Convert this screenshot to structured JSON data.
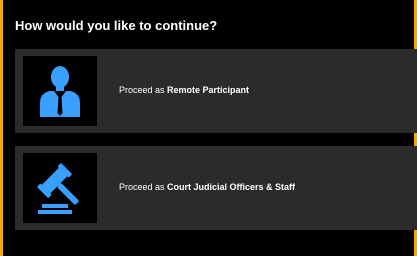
{
  "dialog": {
    "title": "How would you like to continue?"
  },
  "options": [
    {
      "prefix": "Proceed as ",
      "role": "Remote Participant",
      "icon": "person-icon"
    },
    {
      "prefix": "Proceed as ",
      "role": "Court Judicial Officers & Staff",
      "icon": "gavel-icon"
    }
  ],
  "colors": {
    "accent": "#f5a800",
    "icon": "#3aa0ff",
    "card": "#2b2b2b",
    "background": "#000000"
  }
}
